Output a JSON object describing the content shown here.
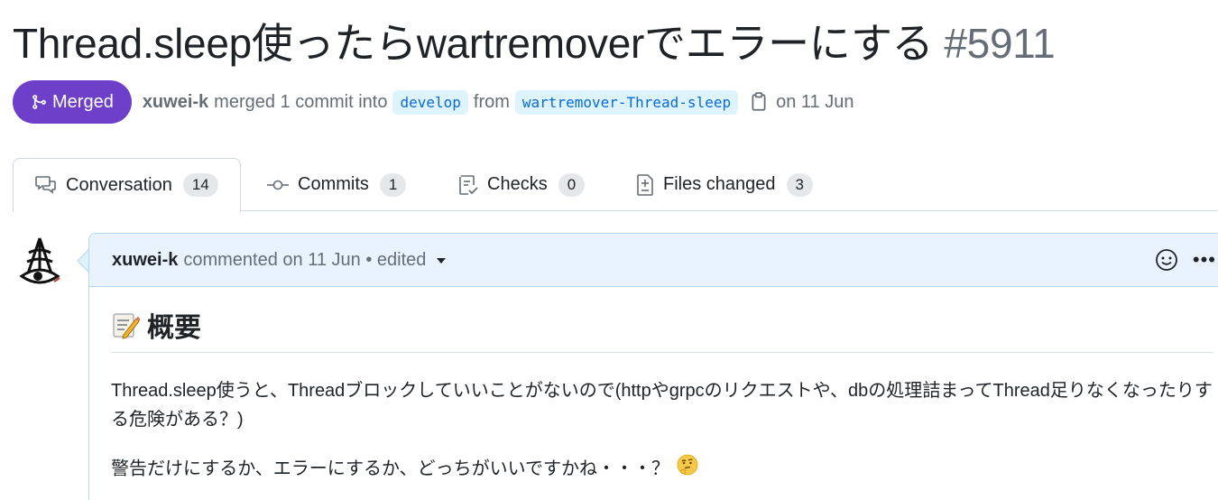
{
  "pr": {
    "title": "Thread.sleep使ったらwartremoverでエラーにする",
    "number": "#5911",
    "state": "Merged",
    "author": "xuwei-k",
    "merged_text": "merged 1 commit into",
    "base_branch": "develop",
    "from_text": "from",
    "head_branch": "wartremover-Thread-sleep",
    "date_text": "on 11 Jun"
  },
  "tabs": [
    {
      "label": "Conversation",
      "count": "14",
      "icon": "comment-discussion-icon"
    },
    {
      "label": "Commits",
      "count": "1",
      "icon": "git-commit-icon"
    },
    {
      "label": "Checks",
      "count": "0",
      "icon": "checklist-icon"
    },
    {
      "label": "Files changed",
      "count": "3",
      "icon": "file-diff-icon"
    }
  ],
  "comment": {
    "author": "xuwei-k",
    "meta": "commented on 11 Jun • edited",
    "heading": "概要",
    "heading_emoji": "memo-icon",
    "paragraph1": "Thread.sleep使うと、Threadブロックしていいことがないので(httpやgrpcのリクエストや、dbの処理詰まってThread足りなくなったりする危険がある？)",
    "paragraph2": "警告だけにするか、エラーにするか、どっちがいいですかね・・・？",
    "paragraph2_emoji": "thinking-face-icon"
  },
  "colors": {
    "merged": "#6e40c9",
    "branch_bg": "#ddf4ff",
    "branch_fg": "#0969da",
    "comment_header_bg": "#e8f3ff",
    "muted": "#656d76"
  }
}
